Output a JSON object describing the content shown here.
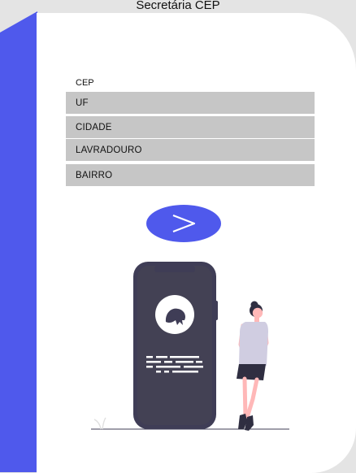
{
  "app": {
    "title": "Secretária CEP"
  },
  "form": {
    "fields": [
      {
        "label": "CEP"
      },
      {
        "label": "UF"
      },
      {
        "label": "CIDADE"
      },
      {
        "label": "LAVRADOURO"
      },
      {
        "label": "BAIRRO"
      }
    ],
    "submit_icon": "arrow-right-icon"
  },
  "colors": {
    "accent": "#4f59ec",
    "background": "#e4e4e4",
    "card": "#ffffff",
    "field": "#c6c6c6",
    "phone": "#3f3d56"
  }
}
